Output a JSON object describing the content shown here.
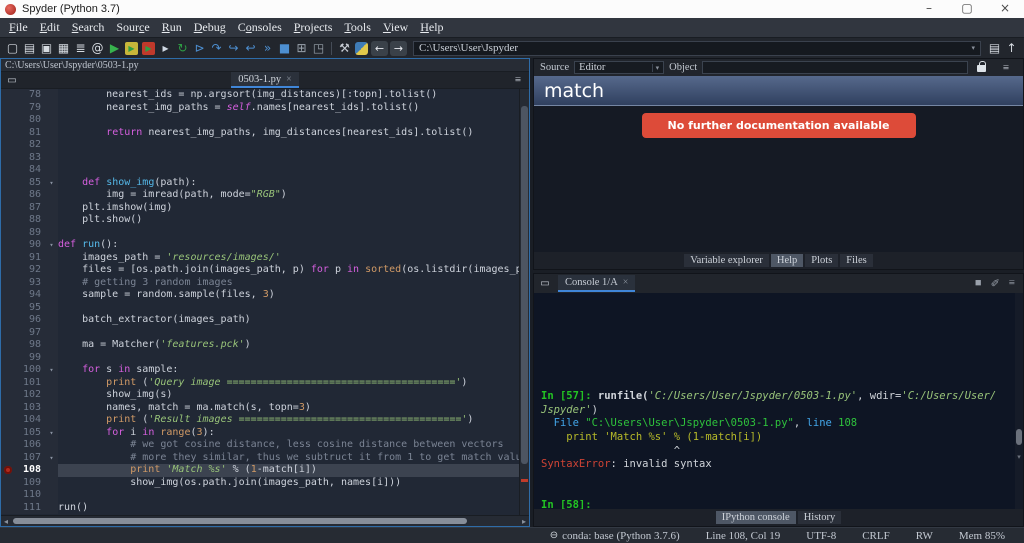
{
  "window": {
    "title": "Spyder (Python 3.7)",
    "controls": {
      "minimize": "–",
      "restore": "▢",
      "close": "×"
    }
  },
  "menu": {
    "items": [
      {
        "label": "File",
        "u": 0
      },
      {
        "label": "Edit",
        "u": 0
      },
      {
        "label": "Search",
        "u": 0
      },
      {
        "label": "Source",
        "u": 4
      },
      {
        "label": "Run",
        "u": 0
      },
      {
        "label": "Debug",
        "u": 0
      },
      {
        "label": "Consoles",
        "u": 1
      },
      {
        "label": "Projects",
        "u": 0
      },
      {
        "label": "Tools",
        "u": 0
      },
      {
        "label": "View",
        "u": 0
      },
      {
        "label": "Help",
        "u": 0
      }
    ]
  },
  "toolbar": {
    "path": "C:\\Users\\User\\Jspyder",
    "caret": "▾",
    "icons": [
      {
        "name": "new-file-icon",
        "glyph": "▢",
        "color": "#d6dbe1"
      },
      {
        "name": "open-file-icon",
        "glyph": "▤",
        "color": "#d6dbe1"
      },
      {
        "name": "save-icon",
        "glyph": "▣",
        "color": "#d6dbe1"
      },
      {
        "name": "save-all-icon",
        "glyph": "▦",
        "color": "#d6dbe1"
      },
      {
        "name": "file-switcher-icon",
        "glyph": "≣",
        "color": "#d6dbe1"
      },
      {
        "name": "code-analysis-icon",
        "glyph": "@",
        "color": "#d6dbe1"
      },
      {
        "name": "run-icon",
        "glyph": "▶",
        "color": "#37b24d"
      },
      {
        "name": "run-cell-icon",
        "glyph": "▶",
        "color": "#2f9e44",
        "bg": "#c7b63a"
      },
      {
        "name": "run-cell-advance-icon",
        "glyph": "▶",
        "color": "#2f9e44",
        "bg": "#c0392b"
      },
      {
        "name": "run-selection-icon",
        "glyph": "▸",
        "color": "#cfd8e3"
      },
      {
        "name": "restart-kernel-icon",
        "glyph": "↻",
        "color": "#2f9e44"
      },
      {
        "name": "debug-icon",
        "glyph": "⊳",
        "color": "#4d8fd1"
      },
      {
        "name": "step-over-icon",
        "glyph": "↷",
        "color": "#4d8fd1"
      },
      {
        "name": "step-into-icon",
        "glyph": "↪",
        "color": "#4d8fd1"
      },
      {
        "name": "step-return-icon",
        "glyph": "↩",
        "color": "#4d8fd1"
      },
      {
        "name": "continue-icon",
        "glyph": "»",
        "color": "#4d8fd1"
      },
      {
        "name": "stop-icon",
        "glyph": "■",
        "color": "#4d8fd1"
      },
      {
        "name": "window-layout-icon",
        "glyph": "⊞",
        "color": "#9aa3ad"
      },
      {
        "name": "fullscreen-icon",
        "glyph": "◳",
        "color": "#9aa3ad"
      },
      {
        "name": "separator",
        "kind": "sep"
      },
      {
        "name": "tools-icon",
        "glyph": "⚒",
        "color": "#c9ced6"
      },
      {
        "name": "python-path-icon",
        "kind": "python"
      },
      {
        "name": "back-icon",
        "glyph": "←",
        "color": "#e6e9ee",
        "kind": "navbtn"
      },
      {
        "name": "forward-icon",
        "glyph": "→",
        "color": "#e6e9ee",
        "kind": "navbtn"
      }
    ],
    "right_icons": [
      {
        "name": "open-working-dir-icon",
        "glyph": "▤",
        "color": "#d6dbe1"
      },
      {
        "name": "parent-dir-icon",
        "glyph": "↑",
        "color": "#d6dbe1"
      }
    ]
  },
  "editor": {
    "path": "C:\\Users\\User\\Jspyder\\0503-1.py",
    "tab": "0503-1.py",
    "tab_close": "×",
    "browse_glyph": "▭",
    "menu_glyph": "≡",
    "hscroll_left": "◂",
    "hscroll_right": "▸",
    "lines": [
      {
        "n": 78,
        "t": [
          [
            "d",
            "        nearest_ids = np.argsort(img_distances)[:topn].tolist()"
          ]
        ]
      },
      {
        "n": 79,
        "t": [
          [
            "d",
            "        nearest_img_paths = "
          ],
          [
            "v",
            "self"
          ],
          [
            "d",
            ".names[nearest_ids].tolist()"
          ]
        ]
      },
      {
        "n": 80,
        "t": []
      },
      {
        "n": 81,
        "t": [
          [
            "d",
            "        "
          ],
          [
            "k",
            "return"
          ],
          [
            "d",
            " nearest_img_paths, img_distances[nearest_ids].tolist()"
          ]
        ]
      },
      {
        "n": 82,
        "t": []
      },
      {
        "n": 83,
        "t": []
      },
      {
        "n": 84,
        "t": []
      },
      {
        "n": 85,
        "fold": true,
        "t": [
          [
            "d",
            "    "
          ],
          [
            "k",
            "def"
          ],
          [
            "d",
            " "
          ],
          [
            "f",
            "show_img"
          ],
          [
            "d",
            "(path):"
          ]
        ]
      },
      {
        "n": 86,
        "t": [
          [
            "d",
            "        img = imread(path, mode="
          ],
          [
            "s",
            "\"RGB\""
          ],
          [
            "d",
            ")"
          ]
        ]
      },
      {
        "n": 87,
        "t": [
          [
            "d",
            "    plt.imshow(img)"
          ]
        ]
      },
      {
        "n": 88,
        "t": [
          [
            "d",
            "    plt.show()"
          ]
        ]
      },
      {
        "n": 89,
        "t": []
      },
      {
        "n": 90,
        "fold": true,
        "t": [
          [
            "k",
            "def"
          ],
          [
            "d",
            " "
          ],
          [
            "f",
            "run"
          ],
          [
            "d",
            "():"
          ]
        ]
      },
      {
        "n": 91,
        "t": [
          [
            "d",
            "    images_path = "
          ],
          [
            "s",
            "'resources/images/'"
          ]
        ]
      },
      {
        "n": 92,
        "t": [
          [
            "d",
            "    files = [os.path.join(images_path, p) "
          ],
          [
            "k",
            "for"
          ],
          [
            "d",
            " p "
          ],
          [
            "k",
            "in"
          ],
          [
            "d",
            " "
          ],
          [
            "b",
            "sorted"
          ],
          [
            "d",
            "(os.listdir(images_p"
          ]
        ]
      },
      {
        "n": 93,
        "t": [
          [
            "d",
            "    "
          ],
          [
            "c",
            "# getting 3 random images"
          ]
        ]
      },
      {
        "n": 94,
        "t": [
          [
            "d",
            "    sample = random.sample(files, "
          ],
          [
            "n",
            "3"
          ],
          [
            "d",
            ")"
          ]
        ]
      },
      {
        "n": 95,
        "t": []
      },
      {
        "n": 96,
        "t": [
          [
            "d",
            "    batch_extractor(images_path)"
          ]
        ]
      },
      {
        "n": 97,
        "t": []
      },
      {
        "n": 98,
        "t": [
          [
            "d",
            "    ma = Matcher("
          ],
          [
            "s",
            "'features.pck'"
          ],
          [
            "d",
            ")"
          ]
        ]
      },
      {
        "n": 99,
        "t": []
      },
      {
        "n": 100,
        "fold": true,
        "t": [
          [
            "d",
            "    "
          ],
          [
            "k",
            "for"
          ],
          [
            "d",
            " s "
          ],
          [
            "k",
            "in"
          ],
          [
            "d",
            " sample:"
          ]
        ]
      },
      {
        "n": 101,
        "t": [
          [
            "d",
            "        "
          ],
          [
            "b",
            "print"
          ],
          [
            "d",
            " ("
          ],
          [
            "s",
            "'Query image ======================================'"
          ],
          [
            "d",
            ")"
          ]
        ]
      },
      {
        "n": 102,
        "t": [
          [
            "d",
            "        show_img(s)"
          ]
        ]
      },
      {
        "n": 103,
        "t": [
          [
            "d",
            "        names, match = ma.match(s, topn="
          ],
          [
            "n",
            "3"
          ],
          [
            "d",
            ")"
          ]
        ]
      },
      {
        "n": 104,
        "t": [
          [
            "d",
            "        "
          ],
          [
            "b",
            "print"
          ],
          [
            "d",
            " ("
          ],
          [
            "s",
            "'Result images ====================================='"
          ],
          [
            "d",
            ")"
          ]
        ]
      },
      {
        "n": 105,
        "fold": true,
        "t": [
          [
            "d",
            "        "
          ],
          [
            "k",
            "for"
          ],
          [
            "d",
            " i "
          ],
          [
            "k",
            "in"
          ],
          [
            "d",
            " "
          ],
          [
            "b",
            "range"
          ],
          [
            "d",
            "("
          ],
          [
            "n",
            "3"
          ],
          [
            "d",
            "):"
          ]
        ]
      },
      {
        "n": 106,
        "t": [
          [
            "d",
            "            "
          ],
          [
            "c",
            "# we got cosine distance, less cosine distance between vectors"
          ]
        ]
      },
      {
        "n": 107,
        "fold": true,
        "t": [
          [
            "d",
            "            "
          ],
          [
            "c",
            "# more they similar, thus we subtruct it from 1 to get match valu"
          ]
        ]
      },
      {
        "n": 108,
        "bp": true,
        "hl": true,
        "t": [
          [
            "d",
            "            "
          ],
          [
            "b",
            "print"
          ],
          [
            "d",
            " "
          ],
          [
            "s",
            "'Match %s'"
          ],
          [
            "d",
            " % ("
          ],
          [
            "n",
            "1"
          ],
          [
            "d",
            "-match[i])"
          ]
        ]
      },
      {
        "n": 109,
        "t": [
          [
            "d",
            "            show_img(os.path.join(images_path, names[i]))"
          ]
        ]
      },
      {
        "n": 110,
        "t": []
      },
      {
        "n": 111,
        "t": [
          [
            "d",
            "run()"
          ]
        ]
      }
    ]
  },
  "help": {
    "source_label": "Source",
    "source_value": "Editor",
    "object_label": "Object",
    "object_value": "",
    "menu_glyph": "≡",
    "title": "match",
    "button_label": "No further documentation available",
    "button_color": "#dd4b39",
    "tabs": {
      "labels": [
        "Variable explorer",
        "Help",
        "Plots",
        "Files"
      ],
      "active": 1
    }
  },
  "console": {
    "tab": "Console 1/A",
    "tab_close": "×",
    "browse_glyph": "▭",
    "menu_glyph": "≡",
    "icons": [
      {
        "name": "kernel-status-icon",
        "glyph": "■"
      },
      {
        "name": "remove-variables-icon",
        "glyph": "✐"
      },
      {
        "name": "options-menu-icon",
        "glyph": "≡"
      }
    ],
    "lines": [
      [],
      [],
      [],
      [],
      [],
      [],
      [],
      [
        [
          "p",
          "In [57]: "
        ],
        [
          "db",
          "runfile("
        ],
        [
          "s",
          "'C:/Users/User/Jspyder/0503-1.py'"
        ],
        [
          "w",
          ", wdir="
        ],
        [
          "s",
          "'C:/Users/User/"
        ]
      ],
      [
        [
          "s",
          "Jspyder'"
        ],
        [
          "w",
          ")"
        ]
      ],
      [
        [
          "fb",
          "  File "
        ],
        [
          "fg",
          "\"C:\\Users\\User\\Jspyder\\0503-1.py\""
        ],
        [
          "w",
          ", "
        ],
        [
          "fb",
          "line "
        ],
        [
          "fg",
          "108"
        ]
      ],
      [
        [
          "y",
          "    print 'Match %s' % (1-match[i])"
        ]
      ],
      [
        [
          "w",
          "                     ^"
        ]
      ],
      [
        [
          "r",
          "SyntaxError"
        ],
        [
          "w",
          ": invalid syntax"
        ]
      ],
      [],
      [],
      [
        [
          "p",
          "In [58]: "
        ]
      ]
    ],
    "tabs": {
      "labels": [
        "IPython console",
        "History"
      ],
      "active": 0
    }
  },
  "statusbar": {
    "items": [
      {
        "name": "conda-env",
        "icon": "⊖",
        "label": "conda: base (Python 3.7.6)"
      },
      {
        "name": "cursor-position",
        "label": "Line 108, Col 19"
      },
      {
        "name": "encoding",
        "label": "UTF-8"
      },
      {
        "name": "eol",
        "label": "CRLF"
      },
      {
        "name": "permissions",
        "label": "RW"
      },
      {
        "name": "memory",
        "label": "Mem 85%"
      }
    ]
  }
}
